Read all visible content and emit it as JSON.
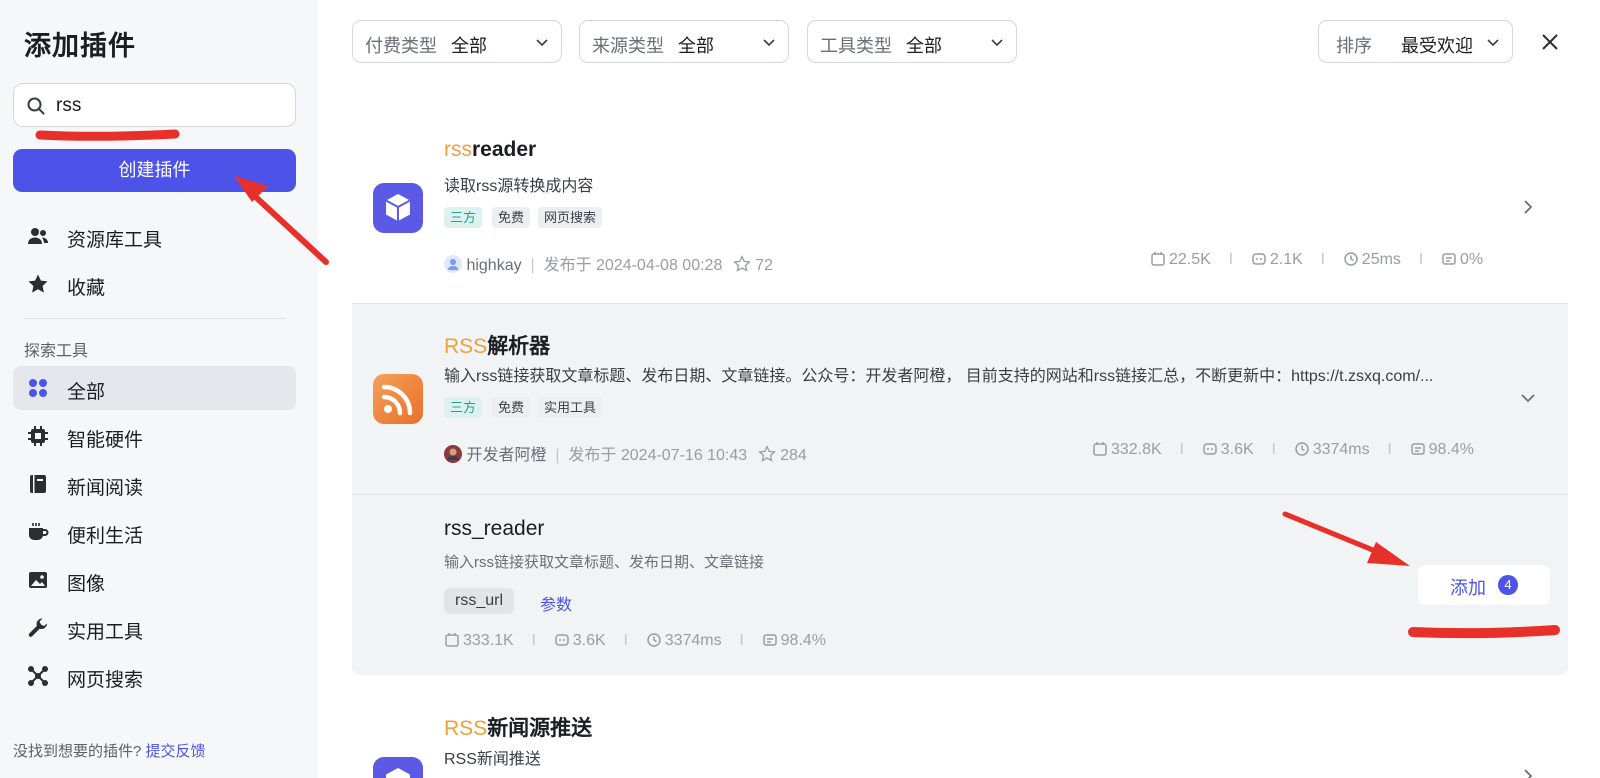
{
  "sidebar": {
    "title": "添加插件",
    "search_value": "rss",
    "create_button": "创建插件",
    "items_top": [
      {
        "label": "资源库工具",
        "icon": "users-icon"
      },
      {
        "label": "收藏",
        "icon": "star-icon"
      }
    ],
    "section_title": "探索工具",
    "items_explore": [
      {
        "label": "全部",
        "icon": "grid-icon",
        "active": true
      },
      {
        "label": "智能硬件",
        "icon": "chip-icon"
      },
      {
        "label": "新闻阅读",
        "icon": "book-icon"
      },
      {
        "label": "便利生活",
        "icon": "coffee-icon"
      },
      {
        "label": "图像",
        "icon": "image-icon"
      },
      {
        "label": "实用工具",
        "icon": "wrench-icon"
      },
      {
        "label": "网页搜索",
        "icon": "network-icon"
      }
    ],
    "footer_text": "没找到想要的插件?",
    "footer_link": "提交反馈"
  },
  "filters": [
    {
      "key": "付费类型",
      "value": "全部"
    },
    {
      "key": "来源类型",
      "value": "全部"
    },
    {
      "key": "工具类型",
      "value": "全部"
    }
  ],
  "sort": {
    "key": "排序",
    "value": "最受欢迎"
  },
  "plugins": [
    {
      "name_highlight": "rss",
      "name_rest": "reader",
      "desc": "读取rss源转换成内容",
      "tags": [
        "三方",
        "免费",
        "网页搜索"
      ],
      "author": "highkay",
      "published": "发布于 2024-04-08 00:28",
      "stars": "72",
      "stats": [
        "22.5K",
        "2.1K",
        "25ms",
        "0%"
      ]
    },
    {
      "name_highlight": "RSS",
      "name_rest": "解析器",
      "desc": "输入rss链接获取文章标题、发布日期、文章链接。公众号：开发者阿橙， 目前支持的网站和rss链接汇总，不断更新中：https://t.zsxq.com/...",
      "tags": [
        "三方",
        "免费",
        "实用工具"
      ],
      "author": "开发者阿橙",
      "published": "发布于 2024-07-16 10:43",
      "stars": "284",
      "stats": [
        "332.8K",
        "3.6K",
        "3374ms",
        "98.4%"
      ],
      "tool": {
        "name": "rss_reader",
        "desc": "输入rss链接获取文章标题、发布日期、文章链接",
        "param": "rss_url",
        "param_link": "参数",
        "stats": [
          "333.1K",
          "3.6K",
          "3374ms",
          "98.4%"
        ],
        "add_label": "添加",
        "add_count": "4"
      }
    },
    {
      "name_highlight": "RSS",
      "name_rest": "新闻源推送",
      "desc": "RSS新闻推送"
    }
  ],
  "colors": {
    "accent": "#4d53e8",
    "highlight": "#f0a03a",
    "annotation": "#e8302a"
  }
}
